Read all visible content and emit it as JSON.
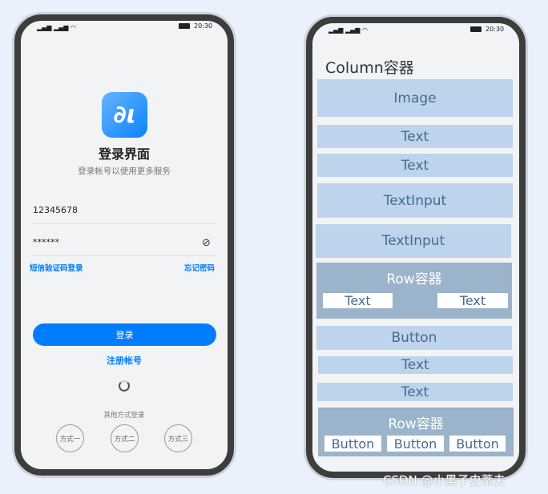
{
  "left_phone": {
    "status": {
      "time": "20:30"
    },
    "app_icon": "app-logo",
    "title": "登录界面",
    "subtitle": "登录帐号以使用更多服务",
    "account_value": "12345678",
    "password_value": "******",
    "sms_login": "短信验证码登录",
    "forgot_password": "忘记密码",
    "login_button": "登录",
    "register": "注册帐号",
    "other_methods": "其他方式登录",
    "methods": [
      "方式一",
      "方式二",
      "方式三"
    ]
  },
  "right_phone": {
    "status": {
      "time": "20:30"
    },
    "title": "Column容器",
    "blocks": [
      "Image",
      "Text",
      "Text",
      "TextInput",
      "TextInput",
      "Button",
      "Text",
      "Text"
    ],
    "row1": {
      "label": "Row容器",
      "items": [
        "Text",
        "Text"
      ]
    },
    "row2": {
      "label": "Row容器",
      "items": [
        "Button",
        "Button",
        "Button"
      ]
    }
  },
  "watermark": "CSDN @小黑子史蒂夫",
  "colors": {
    "accent": "#007dff",
    "block": "#bdd4ec",
    "row": "#9bb3cb"
  }
}
